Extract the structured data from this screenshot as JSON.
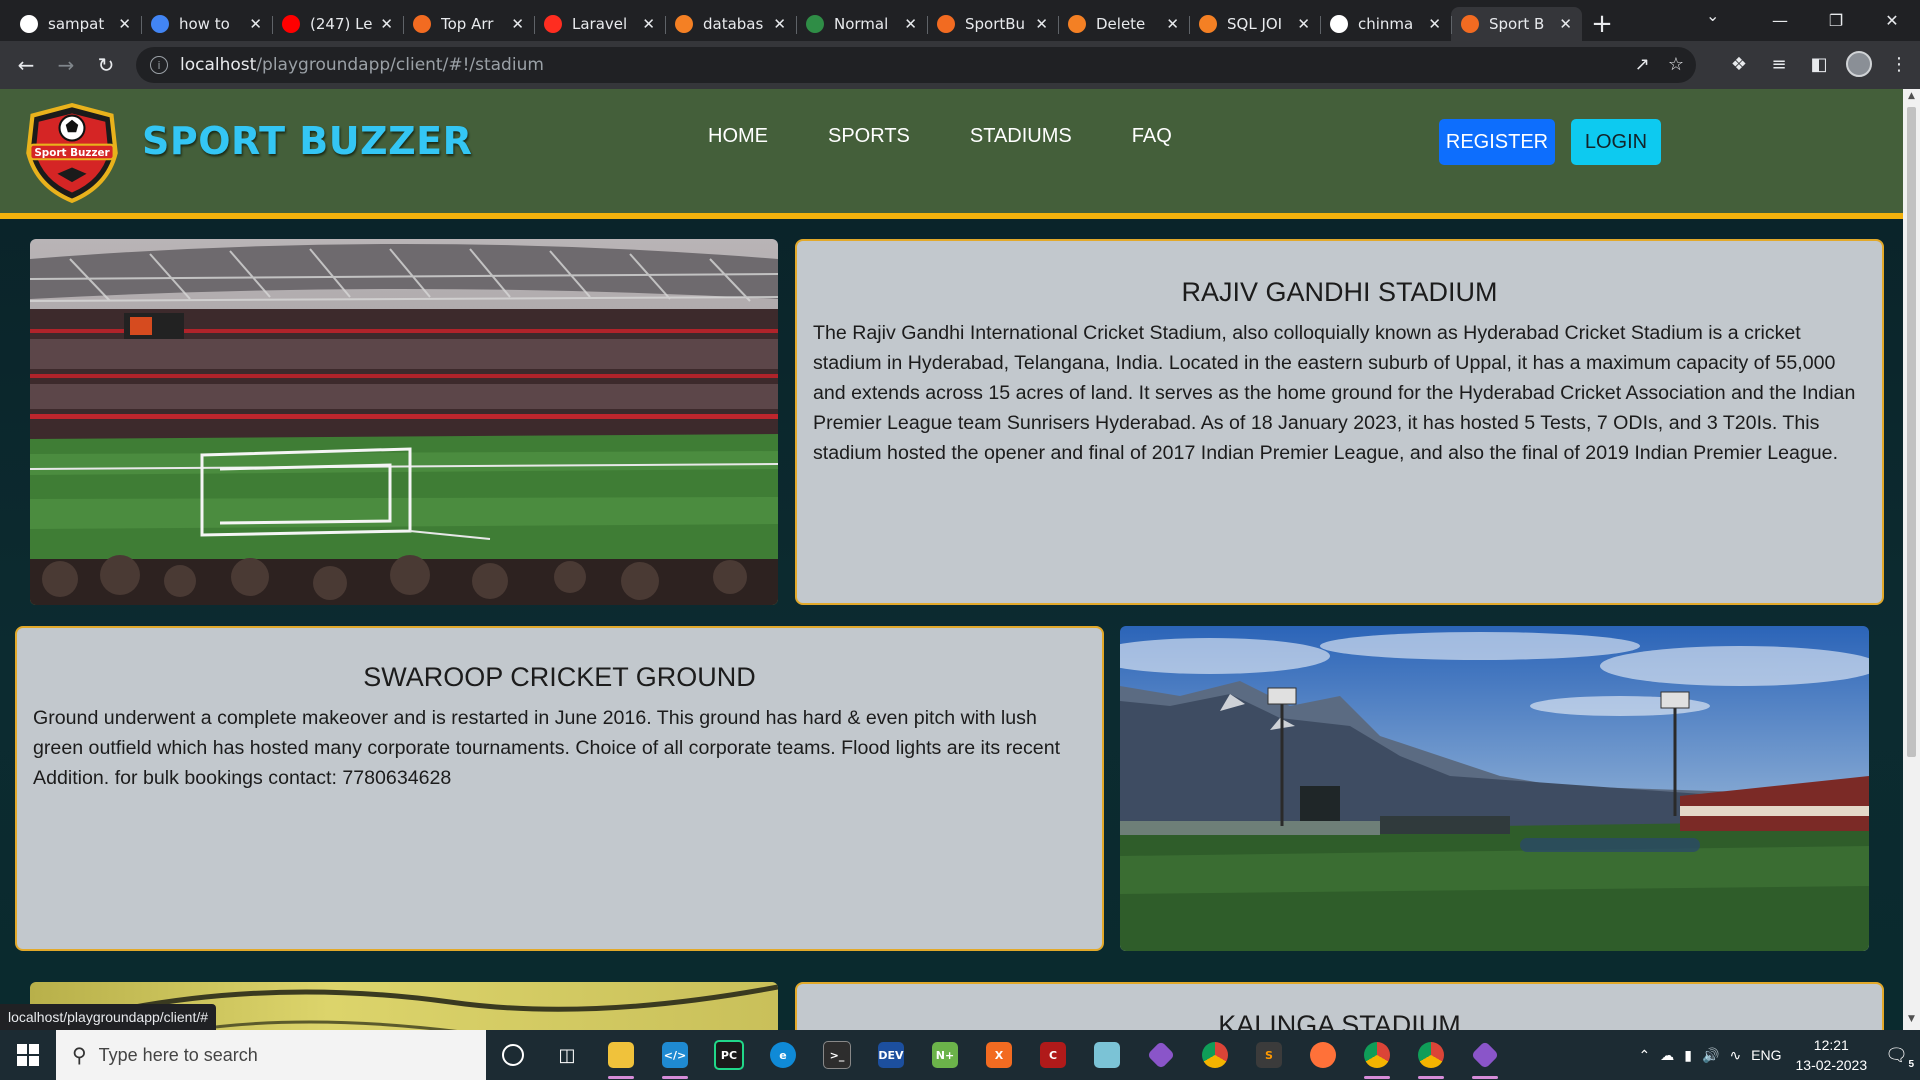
{
  "browser": {
    "tabs": [
      {
        "title": "sampat",
        "icon": "github-icon",
        "color": "#ffffff"
      },
      {
        "title": "how to",
        "icon": "google-icon",
        "color": "#4285f4"
      },
      {
        "title": "(247) Le",
        "icon": "youtube-icon",
        "color": "#ff0000"
      },
      {
        "title": "Top Arr",
        "icon": "codestudio-icon",
        "color": "#f26b21"
      },
      {
        "title": "Laravel",
        "icon": "laravel-icon",
        "color": "#ff2d20"
      },
      {
        "title": "databas",
        "icon": "stackoverflow-icon",
        "color": "#f48024"
      },
      {
        "title": "Normal",
        "icon": "geeksforgeeks-icon",
        "color": "#2f8d46"
      },
      {
        "title": "SportBu",
        "icon": "sportbuzzer-icon",
        "color": "#f26b21"
      },
      {
        "title": "Delete",
        "icon": "stackoverflow-icon",
        "color": "#f48024"
      },
      {
        "title": "SQL JOI",
        "icon": "stackoverflow-icon",
        "color": "#f48024"
      },
      {
        "title": "chinma",
        "icon": "github-icon",
        "color": "#ffffff"
      },
      {
        "title": "Sport B",
        "icon": "sportbuzzer-icon",
        "color": "#f26b21",
        "active": true
      }
    ],
    "url_host": "localhost",
    "url_path": "/playgroundapp/client/#!/stadium",
    "status_url": "localhost/playgroundapp/client/#"
  },
  "site": {
    "brand": "SPORT BUZZER",
    "logo_text": "Sport Buzzer",
    "nav": [
      "HOME",
      "SPORTS",
      "STADIUMS",
      "FAQ"
    ],
    "register": "REGISTER",
    "login": "LOGIN"
  },
  "stadiums": [
    {
      "name": "RAJIV GANDHI STADIUM",
      "description": "The Rajiv Gandhi International Cricket Stadium, also colloquially known as Hyderabad Cricket Stadium is a cricket stadium in Hyderabad, Telangana, India. Located in the eastern suburb of Uppal, it has a maximum capacity of 55,000 and extends across 15 acres of land. It serves as the home ground for the Hyderabad Cricket Association and the Indian Premier League team Sunrisers Hyderabad. As of 18 January 2023, it has hosted 5 Tests, 7 ODIs, and 3 T20Is. This stadium hosted the opener and final of 2017 Indian Premier League, and also the final of 2019 Indian Premier League."
    },
    {
      "name": "SWAROOP CRICKET GROUND",
      "description": "Ground underwent a complete makeover and is restarted in June 2016. This ground has hard & even pitch with lush green outfield which has hosted many corporate tournaments. Choice of all corporate teams. Flood lights are its recent Addition. for bulk bookings contact: 7780634628"
    },
    {
      "name": "KALINGA STADIUM",
      "description": ""
    }
  ],
  "taskbar": {
    "search_placeholder": "Type here to search",
    "lang": "ENG",
    "time": "12:21",
    "date": "13-02-2023",
    "notifications": "5"
  }
}
